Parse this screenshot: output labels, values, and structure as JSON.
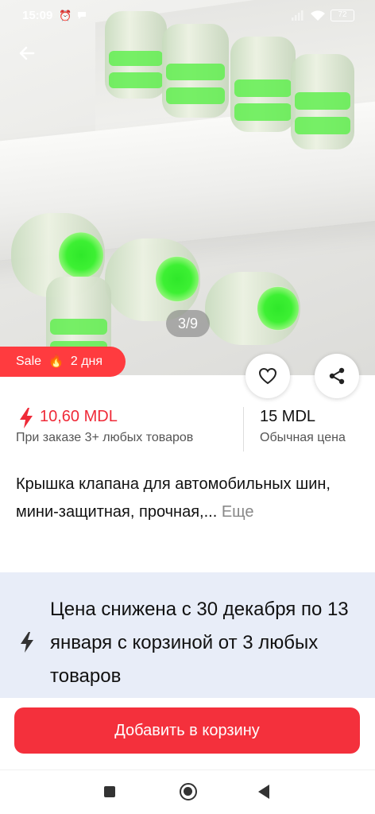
{
  "status_bar": {
    "time": "15:09",
    "battery": "72"
  },
  "gallery": {
    "counter": "3/9"
  },
  "sale_badge": {
    "label": "Sale",
    "emoji": "🔥",
    "days": "2 дня"
  },
  "price": {
    "promo_value": "10,60 MDL",
    "promo_note": "При заказе 3+ любых товаров",
    "regular_value": "15 MDL",
    "regular_note": "Обычная цена"
  },
  "product": {
    "title": "Крышка клапана для автомобильных шин, мини-защитная, прочная,...",
    "more_label": "Еще"
  },
  "notice": {
    "text": "Цена снижена с 30 декабря по 13 января с корзиной от 3 любых товаров"
  },
  "cart": {
    "add_label": "Добавить в корзину"
  },
  "colors": {
    "accent": "#f4303c",
    "sale": "#ff3b3f",
    "promo_price": "#ef2a38",
    "notice_bg": "#e8edf8"
  }
}
